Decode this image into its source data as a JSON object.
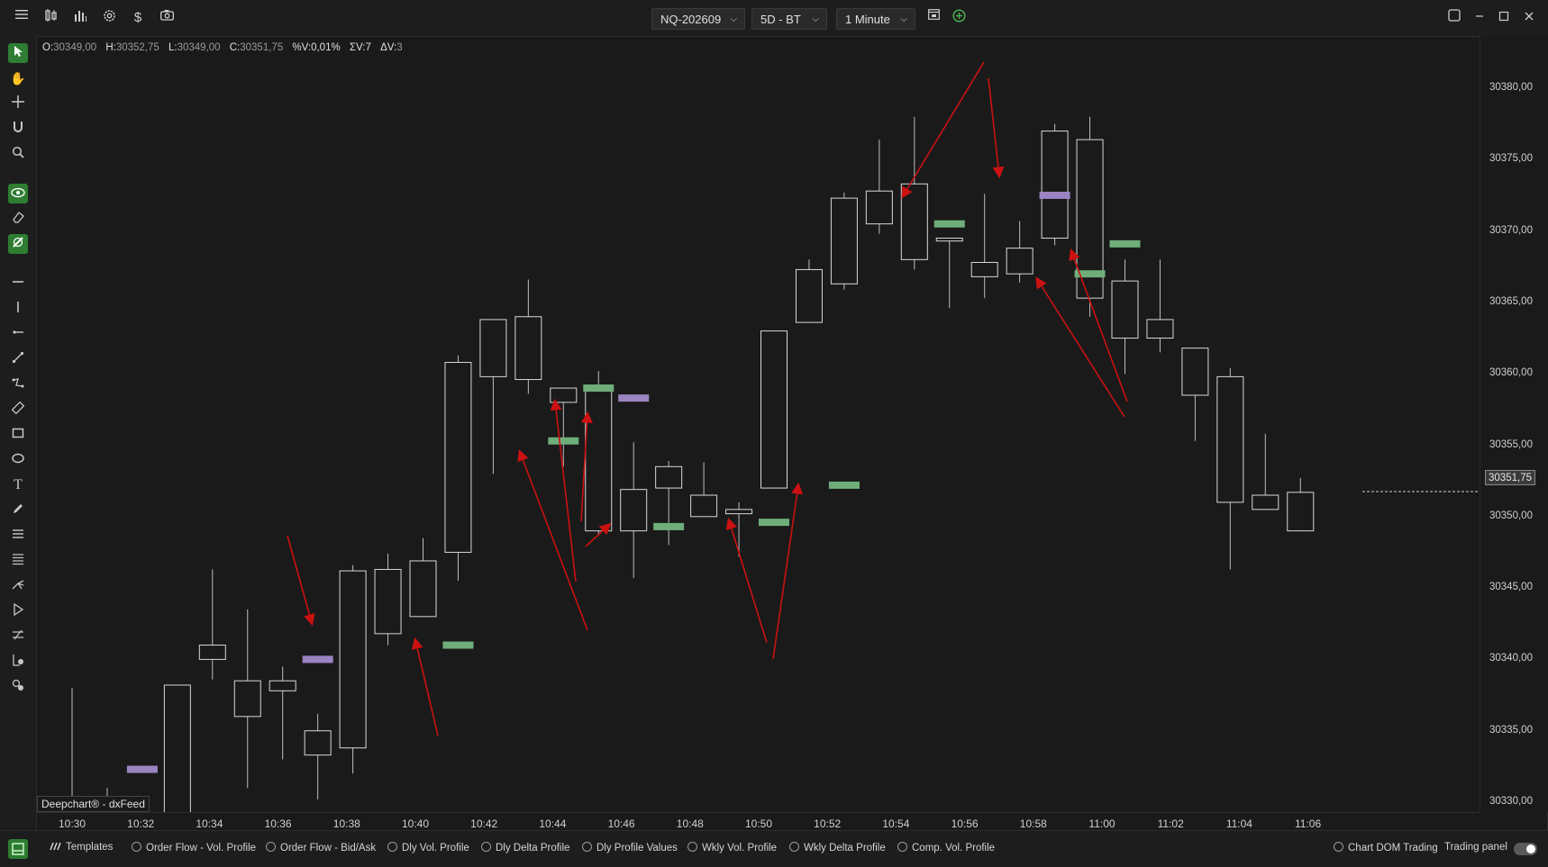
{
  "toolbar": {
    "icons": [
      "menu-icon",
      "chart-type-icon",
      "indicators-icon",
      "settings-icon",
      "dollar-icon",
      "camera-icon",
      "template-icon",
      "add-icon"
    ],
    "symbol": "NQ-202609",
    "timeframe_range": "5D - BT",
    "interval": "1 Minute"
  },
  "window": {
    "icons": [
      "restore-icon",
      "minimize-icon",
      "maximize-icon",
      "close-icon"
    ]
  },
  "ohlc": {
    "o_label": "O:",
    "o_value": "30349,00",
    "h_label": "H:",
    "h_value": "30352,75",
    "l_label": "L:",
    "l_value": "30349,00",
    "c_label": "C:",
    "c_value": "30351,75",
    "pv_label": "%V:",
    "pv_value": "0,01%",
    "sv_label": "ΣV:",
    "sv_value": "7",
    "dv_label": "ΔV:",
    "dv_value": "3"
  },
  "left_tools": [
    "cursor-icon",
    "hand-icon",
    "crosshair-icon",
    "magnet-icon",
    "zoom-icon",
    "eye-icon",
    "eraser-icon",
    "lock-icon",
    "horizontal-line-icon",
    "vertical-line-icon",
    "ray-icon",
    "trendline-icon",
    "polyline-icon",
    "ruler-icon",
    "rectangle-icon",
    "ellipse-icon",
    "text-icon",
    "pencil-icon",
    "fibonacci-icon",
    "levels-icon",
    "pitchfork-icon",
    "projection-icon",
    "channel-icon",
    "order-icon",
    "alert-icon"
  ],
  "watermark": "Deepchart® - dxFeed",
  "current_price_label": "30351,75",
  "chart_data": {
    "type": "candlestick",
    "title": "",
    "price_min": 30327.5,
    "price_max": 30382.5,
    "price_ticks": [
      "30380,00",
      "30375,00",
      "30370,00",
      "30365,00",
      "30360,00",
      "30355,00",
      "30350,00",
      "30345,00",
      "30340,00",
      "30335,00",
      "30330,00"
    ],
    "price_tick_values": [
      30380,
      30375,
      30370,
      30365,
      30360,
      30355,
      30350,
      30345,
      30340,
      30335,
      30330
    ],
    "time_ticks": [
      "10:30",
      "10:32",
      "10:34",
      "10:36",
      "10:38",
      "10:40",
      "10:42",
      "10:44",
      "10:46",
      "10:48",
      "10:50",
      "10:52",
      "10:54",
      "10:56",
      "10:58",
      "11:00",
      "11:02",
      "11:04",
      "11:06"
    ],
    "candles": [
      {
        "o": 30329.0,
        "h": 30338.0,
        "l": 30329.0,
        "c": 30330.2
      },
      {
        "o": 30330.0,
        "h": 30331.0,
        "l": 30329.0,
        "c": 30329.0
      },
      {
        "o": 30329.0,
        "h": 30330.0,
        "l": 30329.0,
        "c": 30329.2
      },
      {
        "o": 30329.0,
        "h": 30337.8,
        "l": 30329.0,
        "c": 30338.2
      },
      {
        "o": 30340.0,
        "h": 30346.3,
        "l": 30338.6,
        "c": 30341.0
      },
      {
        "o": 30336.0,
        "h": 30343.5,
        "l": 30331.0,
        "c": 30338.5
      },
      {
        "o": 30337.8,
        "h": 30339.5,
        "l": 30333.0,
        "c": 30338.5
      },
      {
        "o": 30335.0,
        "h": 30336.2,
        "l": 30330.2,
        "c": 30333.3
      },
      {
        "o": 30333.8,
        "h": 30346.6,
        "l": 30332.0,
        "c": 30346.2
      },
      {
        "o": 30341.8,
        "h": 30347.4,
        "l": 30341.0,
        "c": 30346.3
      },
      {
        "o": 30343.0,
        "h": 30348.5,
        "l": 30343.0,
        "c": 30346.9
      },
      {
        "o": 30347.5,
        "h": 30361.3,
        "l": 30345.5,
        "c": 30360.8
      },
      {
        "o": 30359.8,
        "h": 30363.8,
        "l": 30353.0,
        "c": 30363.8
      },
      {
        "o": 30359.6,
        "h": 30366.6,
        "l": 30358.6,
        "c": 30364.0
      },
      {
        "o": 30359.0,
        "h": 30357.5,
        "l": 30353.5,
        "c": 30358.0
      },
      {
        "o": 30349.0,
        "h": 30360.2,
        "l": 30348.7,
        "c": 30359.0
      },
      {
        "o": 30349.0,
        "h": 30355.2,
        "l": 30345.7,
        "c": 30351.9
      },
      {
        "o": 30352.0,
        "h": 30353.9,
        "l": 30348.0,
        "c": 30353.5
      },
      {
        "o": 30351.5,
        "h": 30353.8,
        "l": 30350.0,
        "c": 30350.0
      },
      {
        "o": 30350.2,
        "h": 30351.0,
        "l": 30347.2,
        "c": 30350.5
      },
      {
        "o": 30352.0,
        "h": 30363.0,
        "l": 30352.0,
        "c": 30363.0
      },
      {
        "o": 30363.6,
        "h": 30368.0,
        "l": 30363.6,
        "c": 30367.3
      },
      {
        "o": 30366.3,
        "h": 30372.7,
        "l": 30365.9,
        "c": 30372.3
      },
      {
        "o": 30370.5,
        "h": 30376.4,
        "l": 30369.8,
        "c": 30372.8
      },
      {
        "o": 30368.0,
        "h": 30378.0,
        "l": 30367.3,
        "c": 30373.3
      },
      {
        "o": 30369.5,
        "h": 30369.5,
        "l": 30364.6,
        "c": 30369.3
      },
      {
        "o": 30367.8,
        "h": 30372.6,
        "l": 30365.3,
        "c": 30366.8
      },
      {
        "o": 30368.8,
        "h": 30370.7,
        "l": 30366.4,
        "c": 30367.0
      },
      {
        "o": 30369.5,
        "h": 30377.5,
        "l": 30369.0,
        "c": 30377.0
      },
      {
        "o": 30376.4,
        "h": 30378.0,
        "l": 30364.0,
        "c": 30365.3
      },
      {
        "o": 30366.5,
        "h": 30368.0,
        "l": 30360.0,
        "c": 30362.5
      },
      {
        "o": 30362.5,
        "h": 30368.0,
        "l": 30361.5,
        "c": 30363.8
      },
      {
        "o": 30361.8,
        "h": 30361.8,
        "l": 30355.3,
        "c": 30358.5
      },
      {
        "o": 30359.8,
        "h": 30360.4,
        "l": 30346.3,
        "c": 30351.0
      },
      {
        "o": 30351.5,
        "h": 30355.8,
        "l": 30350.5,
        "c": 30350.5
      },
      {
        "o": 30349.0,
        "h": 30352.7,
        "l": 30349.0,
        "c": 30351.7
      }
    ],
    "markers": [
      {
        "bar": 2,
        "price": 30332.3,
        "color": "purple"
      },
      {
        "bar": 7,
        "price": 30340.0,
        "color": "purple"
      },
      {
        "bar": 11,
        "price": 30341.0,
        "color": "green"
      },
      {
        "bar": 14,
        "price": 30355.3,
        "color": "green"
      },
      {
        "bar": 15,
        "price": 30359.0,
        "color": "green"
      },
      {
        "bar": 16,
        "price": 30358.3,
        "color": "purple"
      },
      {
        "bar": 17,
        "price": 30349.3,
        "color": "green"
      },
      {
        "bar": 20,
        "price": 30349.6,
        "color": "green"
      },
      {
        "bar": 22,
        "price": 30352.2,
        "color": "green"
      },
      {
        "bar": 25,
        "price": 30370.5,
        "color": "green"
      },
      {
        "bar": 28,
        "price": 30372.5,
        "color": "purple"
      },
      {
        "bar": 29,
        "price": 30367.0,
        "color": "green"
      },
      {
        "bar": 30,
        "price": 30369.1,
        "color": "green"
      }
    ],
    "current_price": 30351.75,
    "colors": {
      "candle_border": "#d8d8d8",
      "background": "#1a1a1a",
      "marker_green": "#6fae7a",
      "marker_purple": "#9b84c2",
      "arrow": "#cc1111"
    }
  },
  "bottom": {
    "templates_label": "Templates",
    "profiles": [
      "Order Flow - Vol. Profile",
      "Order Flow - Bid/Ask",
      "Dly Vol. Profile",
      "Dly Delta Profile",
      "Dly Profile Values",
      "Wkly Vol. Profile",
      "Wkly Delta Profile",
      "Comp. Vol. Profile"
    ],
    "chart_dom_label": "Chart DOM Trading",
    "trading_panel_label": "Trading panel"
  }
}
